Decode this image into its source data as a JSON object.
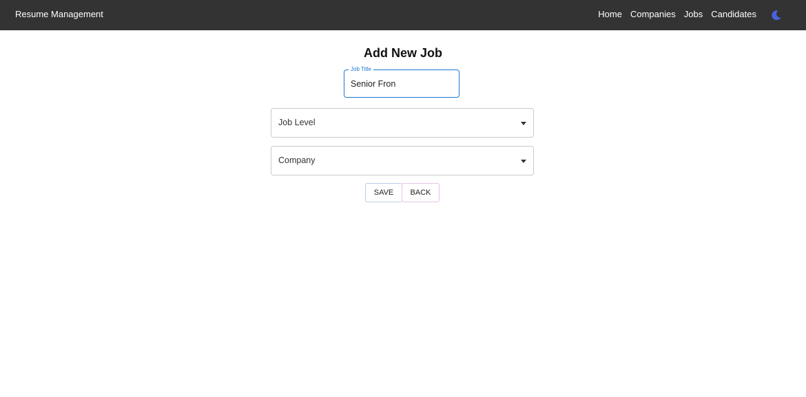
{
  "navbar": {
    "brand": "Resume Management",
    "links": [
      "Home",
      "Companies",
      "Jobs",
      "Candidates"
    ],
    "theme_icon": "moon-icon",
    "theme_color": "#4a62d8",
    "background": "#333333"
  },
  "form": {
    "title": "Add New Job",
    "job_title": {
      "label": "Job Title",
      "value": "Senior Fron"
    },
    "job_level": {
      "label": "Job Level"
    },
    "company": {
      "label": "Company"
    },
    "buttons": {
      "save": "SAVE",
      "back": "BACK"
    },
    "accent_color": "#1976d2"
  }
}
